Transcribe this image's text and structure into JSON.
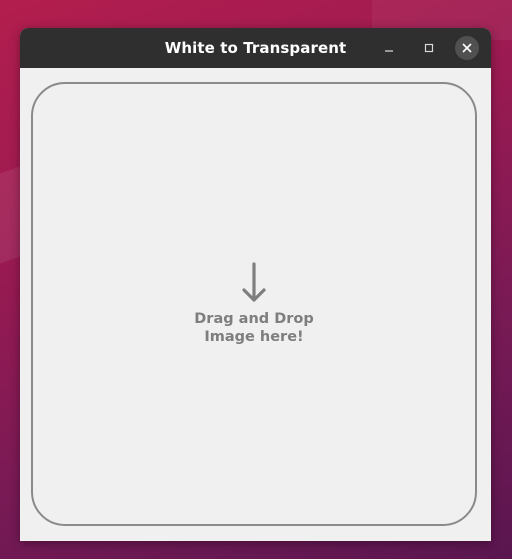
{
  "window": {
    "title": "White to Transparent"
  },
  "controls": {
    "minimize_icon": "minimize-icon",
    "maximize_icon": "maximize-icon",
    "close_icon": "close-icon"
  },
  "drop_zone": {
    "icon": "down-arrow-icon",
    "line1": "Drag and Drop",
    "line2": "Image here!"
  },
  "colors": {
    "titlebar": "#2f2f2f",
    "content_bg": "#f0f0f0",
    "drop_border": "#8a8a8a",
    "drop_text": "#7e7e7e",
    "desktop_bg": "#9a1a52"
  }
}
